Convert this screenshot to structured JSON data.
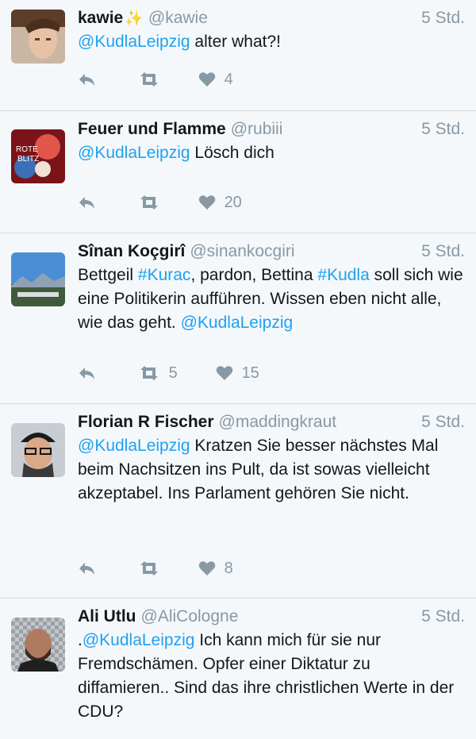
{
  "tweets": [
    {
      "name": "kawie",
      "sparkle": "✨",
      "handle": "@kawie",
      "time": "5 Std.",
      "parts": [
        {
          "t": "@KudlaLeipzig",
          "link": true
        },
        {
          "t": " alter what?!",
          "link": false
        }
      ],
      "retweets": "",
      "likes": "4",
      "avatar_icon": "avatar-photo"
    },
    {
      "name": "Feuer und Flamme",
      "handle": "@rubiii",
      "time": "5 Std.",
      "parts": [
        {
          "t": "@KudlaLeipzig",
          "link": true
        },
        {
          "t": " Lösch dich",
          "link": false
        }
      ],
      "retweets": "",
      "likes": "20",
      "avatar_icon": "avatar-photo"
    },
    {
      "name": "Sînan Koçgirî",
      "handle": "@sinankocgiri",
      "time": "5 Std.",
      "parts": [
        {
          "t": "Bettgeil ",
          "link": false
        },
        {
          "t": "#Kurac",
          "link": true
        },
        {
          "t": ", pardon, Bettina ",
          "link": false
        },
        {
          "t": "#Kudla",
          "link": true
        },
        {
          "t": " soll sich wie eine Politikerin aufführen. Wissen eben nicht alle, wie das geht. ",
          "link": false
        },
        {
          "t": "@KudlaLeipzig",
          "link": true
        }
      ],
      "retweets": "5",
      "likes": "15",
      "avatar_icon": "avatar-photo"
    },
    {
      "name": "Florian R Fischer",
      "handle": "@maddingkraut",
      "time": "5 Std.",
      "parts": [
        {
          "t": "@KudlaLeipzig",
          "link": true
        },
        {
          "t": " Kratzen Sie besser nächstes Mal beim Nachsitzen ins Pult, da ist sowas vielleicht akzeptabel. Ins Parlament gehören Sie nicht.",
          "link": false
        }
      ],
      "retweets": "",
      "likes": "8",
      "avatar_icon": "avatar-photo"
    },
    {
      "name": "Ali Utlu",
      "handle": "@AliCologne",
      "time": "5 Std.",
      "parts": [
        {
          "t": ".",
          "link": false
        },
        {
          "t": "@KudlaLeipzig",
          "link": true
        },
        {
          "t": " Ich kann mich für sie nur Fremdschämen. Opfer einer Diktatur zu diffamieren.. Sind das ihre christlichen Werte in der CDU?",
          "link": false
        }
      ],
      "retweets": "",
      "likes": "",
      "avatar_icon": "avatar-photo"
    }
  ],
  "icons": {
    "reply": "reply-icon",
    "retweet": "retweet-icon",
    "like": "heart-icon"
  },
  "colors": {
    "link": "#1da1f2",
    "muted": "#8899a6",
    "background": "#f5f8fa"
  }
}
